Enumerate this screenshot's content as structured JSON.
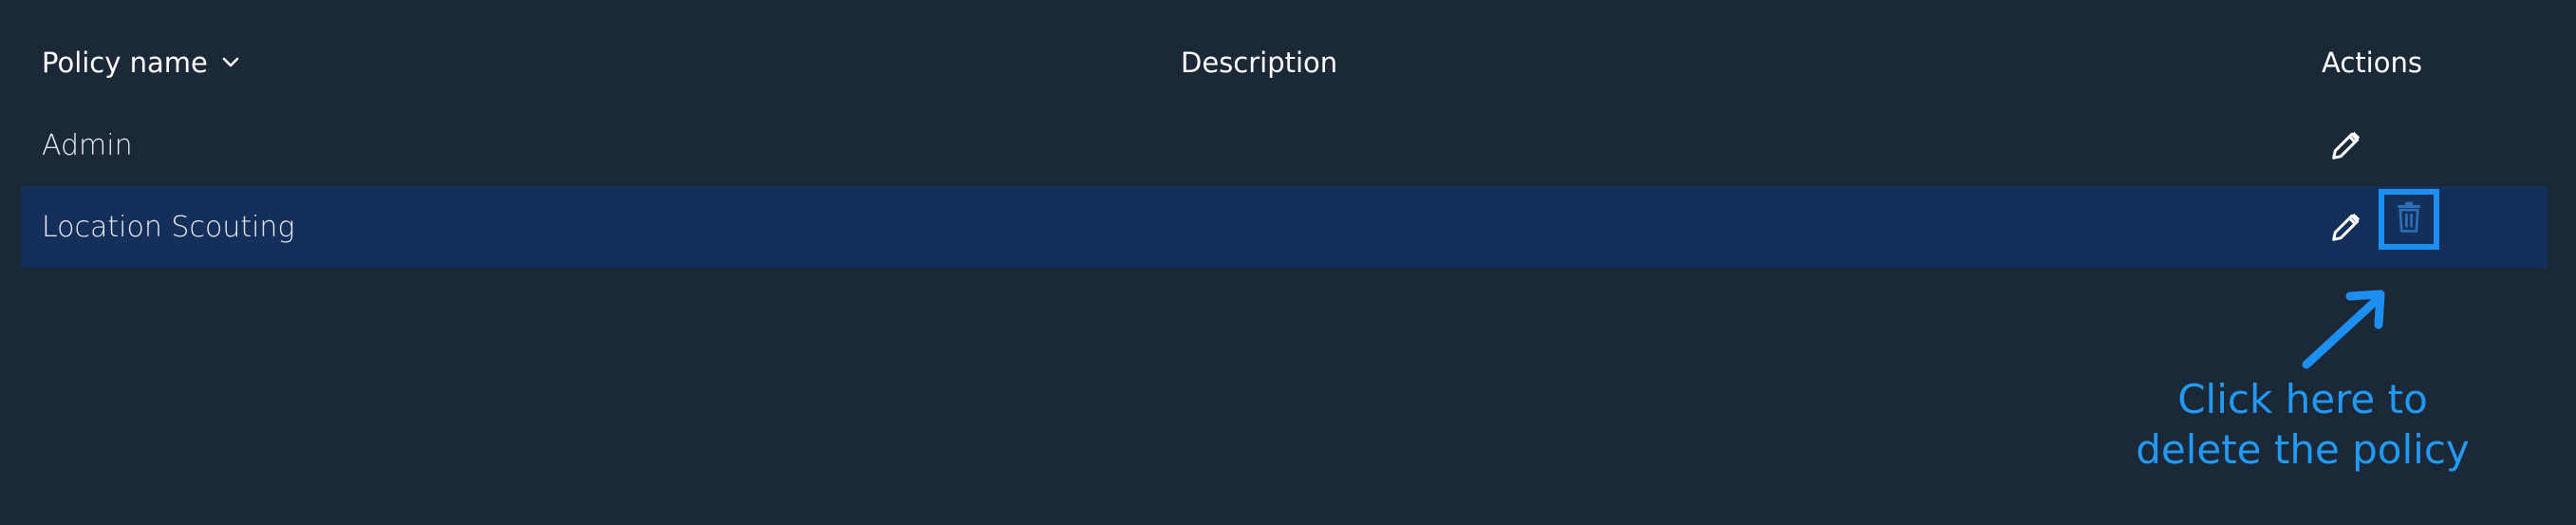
{
  "table": {
    "headers": {
      "policy_name": "Policy name",
      "description": "Description",
      "actions": "Actions"
    },
    "rows": [
      {
        "name": "Admin",
        "description": ""
      },
      {
        "name": "Location Scouting",
        "description": ""
      }
    ]
  },
  "annotation": {
    "callout_line1": "Click here to",
    "callout_line2": "delete the policy"
  },
  "icons": {
    "sort": "chevron-down-icon",
    "edit": "pencil-icon",
    "delete": "trash-icon",
    "arrow": "arrow-up-right-icon"
  },
  "colors": {
    "background": "#1b2838",
    "highlight_row": "#14305a",
    "accent": "#1d8ff0",
    "text": "#ffffff"
  }
}
